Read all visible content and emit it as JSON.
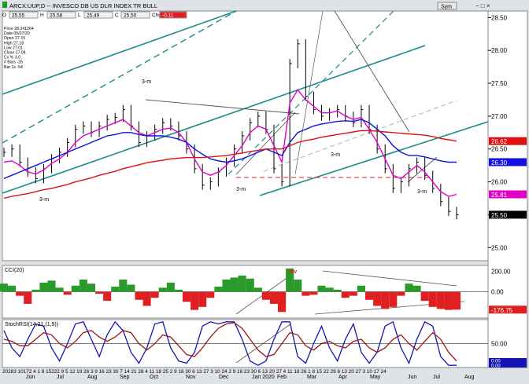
{
  "header": {
    "title": "ARCX:UUP,D -- INVESCO DB US DLR INDEX TR BULL",
    "open_label": "O",
    "open": "25.55",
    "high_label": "H",
    "high": "25.58",
    "low_label": "L",
    "low": "25.49",
    "close_label": "C",
    "close": "25.50",
    "change_label": "Chg",
    "change": "-0.11",
    "symbol_button": "Sym",
    "colors": {
      "up": "#1a9a1a",
      "down": "#e02020",
      "change_bg": "#e02020"
    }
  },
  "info_panel": {
    "lines": [
      "Price 28.241264",
      "Date 05/07/20",
      "Open 27.15",
      "High 27.18",
      "Low 27.01",
      "Close 27.04",
      "Cx % 3.0",
      "# Bars -26",
      "Bar 1s -54"
    ]
  },
  "chart_data": [
    {
      "panel": "price",
      "type": "line",
      "ylim": [
        24.8,
        28.6
      ],
      "y_ticks": [
        "28.50",
        "28.00",
        "27.50",
        "27.00",
        "26.50",
        "26.00",
        "25.50",
        "25.00"
      ],
      "x": [
        0,
        5,
        10,
        15,
        20,
        25,
        30,
        35,
        40,
        45,
        50,
        55,
        60,
        65,
        70,
        75,
        80,
        85,
        90,
        95,
        100,
        105,
        110,
        115,
        120,
        125,
        130,
        135,
        140,
        145,
        150,
        155,
        160,
        165,
        170,
        175,
        180,
        185,
        190,
        195,
        200,
        205,
        210,
        215,
        220,
        225,
        230,
        235,
        240,
        245,
        250,
        255,
        260,
        265,
        270,
        275,
        280,
        284
      ],
      "series": [
        {
          "values": [
            26.45,
            26.5,
            26.3,
            26.15,
            26.05,
            26.2,
            26.35,
            26.45,
            26.6,
            26.8,
            26.85,
            26.75,
            26.85,
            26.95,
            26.98,
            27.1,
            26.85,
            26.6,
            26.7,
            26.8,
            26.9,
            26.85,
            26.7,
            26.5,
            26.2,
            25.95,
            26.0,
            26.15,
            26.3,
            26.5,
            26.7,
            26.9,
            27.0,
            26.8,
            26.2,
            26.0,
            27.8,
            28.1,
            27.3,
            27.1,
            27.0,
            27.05,
            27.1,
            27.0,
            26.9,
            27.1,
            26.8,
            26.5,
            26.2,
            25.9,
            26.0,
            26.2,
            26.3,
            26.1,
            25.9,
            25.7,
            25.55,
            25.5
          ],
          "color": "#000000"
        },
        {
          "values": [
            26.3,
            26.32,
            26.25,
            26.15,
            26.12,
            26.18,
            26.28,
            26.35,
            26.45,
            26.6,
            26.7,
            26.75,
            26.8,
            26.85,
            26.9,
            26.95,
            26.85,
            26.75,
            26.7,
            26.75,
            26.8,
            26.82,
            26.75,
            26.6,
            26.35,
            26.15,
            26.1,
            26.15,
            26.25,
            26.4,
            26.55,
            26.75,
            26.85,
            26.8,
            26.55,
            26.3,
            27.2,
            27.4,
            27.25,
            27.15,
            27.05,
            27.05,
            27.08,
            27.0,
            26.95,
            26.98,
            26.8,
            26.6,
            26.35,
            26.1,
            26.05,
            26.15,
            26.25,
            26.15,
            26.0,
            25.85,
            25.78,
            25.81
          ],
          "color": "#e000c8"
        },
        {
          "values": [
            26.05,
            26.1,
            26.15,
            26.2,
            26.25,
            26.3,
            26.35,
            26.4,
            26.45,
            26.5,
            26.55,
            26.6,
            26.65,
            26.7,
            26.72,
            26.75,
            26.75,
            26.72,
            26.7,
            26.7,
            26.7,
            26.68,
            26.65,
            26.6,
            26.5,
            26.42,
            26.35,
            26.32,
            26.3,
            26.32,
            26.35,
            26.4,
            26.45,
            26.5,
            26.45,
            26.4,
            26.6,
            26.75,
            26.8,
            26.85,
            26.88,
            26.9,
            26.92,
            26.93,
            26.92,
            26.95,
            26.9,
            26.8,
            26.7,
            26.55,
            26.45,
            26.4,
            26.4,
            26.38,
            26.35,
            26.32,
            26.3,
            26.3
          ],
          "color": "#1010e0"
        },
        {
          "values": [
            25.75,
            25.78,
            25.8,
            25.82,
            25.85,
            25.88,
            25.9,
            25.93,
            25.96,
            26.0,
            26.03,
            26.06,
            26.1,
            26.13,
            26.16,
            26.2,
            26.23,
            26.26,
            26.29,
            26.31,
            26.33,
            26.35,
            26.36,
            26.37,
            26.37,
            26.37,
            26.38,
            26.39,
            26.4,
            26.42,
            26.44,
            26.46,
            26.48,
            26.5,
            26.5,
            26.5,
            26.55,
            26.6,
            26.63,
            26.65,
            26.68,
            26.7,
            26.72,
            26.74,
            26.76,
            26.78,
            26.78,
            26.77,
            26.76,
            26.75,
            26.74,
            26.73,
            26.72,
            26.71,
            26.69,
            26.66,
            26.64,
            26.62
          ],
          "color": "#e01010"
        }
      ],
      "value_tags": [
        {
          "value": "26.62",
          "y": 26.62,
          "color": "#e01010"
        },
        {
          "value": "26.30",
          "y": 26.3,
          "color": "#1010e0"
        },
        {
          "value": "25.81",
          "y": 25.81,
          "color": "#e000c8"
        },
        {
          "value": "25.50",
          "y": 25.5,
          "color": "#000000"
        }
      ],
      "annotations": [
        "3-m",
        "3-m",
        "3-m",
        "3-m",
        "3-m"
      ]
    },
    {
      "panel": "cci",
      "title": "CCI(20)",
      "type": "area",
      "ylim": [
        -260,
        260
      ],
      "y_ticks": [
        "200.00",
        "0.00"
      ],
      "value_tag": "-176.75",
      "annotation": "div",
      "values": [
        80,
        60,
        -40,
        -120,
        20,
        90,
        110,
        40,
        -30,
        60,
        120,
        80,
        -20,
        -90,
        50,
        120,
        70,
        -80,
        -140,
        -60,
        40,
        90,
        20,
        -100,
        -180,
        -150,
        -60,
        50,
        120,
        140,
        160,
        130,
        40,
        -80,
        -120,
        -200,
        230,
        120,
        -40,
        -30,
        60,
        40,
        20,
        -60,
        -40,
        60,
        -80,
        -140,
        -170,
        -150,
        -40,
        80,
        60,
        -90,
        -150,
        -170,
        -180,
        -176.75
      ]
    },
    {
      "panel": "stochrsi",
      "title": "StochRSI(14,21,(1,9))",
      "type": "line",
      "ylim": [
        -5,
        105
      ],
      "y_ticks": [
        "50.00",
        "0.00"
      ],
      "value_tags": [
        "0.00",
        "0.00"
      ],
      "series": [
        {
          "values": [
            80,
            40,
            20,
            60,
            95,
            90,
            40,
            10,
            50,
            95,
            100,
            60,
            20,
            70,
            100,
            80,
            30,
            5,
            40,
            95,
            100,
            40,
            10,
            5,
            30,
            90,
            100,
            95,
            100,
            100,
            60,
            10,
            0,
            10,
            60,
            100,
            100,
            20,
            5,
            50,
            90,
            40,
            10,
            60,
            95,
            30,
            5,
            30,
            90,
            100,
            40,
            5,
            60,
            100,
            90,
            20,
            0,
            0
          ],
          "color": "#1414b4"
        },
        {
          "values": [
            60,
            55,
            45,
            45,
            60,
            75,
            70,
            50,
            40,
            55,
            75,
            80,
            65,
            55,
            65,
            80,
            75,
            50,
            35,
            50,
            70,
            65,
            45,
            25,
            20,
            40,
            65,
            85,
            95,
            98,
            85,
            60,
            35,
            20,
            25,
            50,
            75,
            70,
            45,
            35,
            50,
            55,
            45,
            40,
            55,
            60,
            40,
            30,
            40,
            60,
            70,
            50,
            35,
            55,
            75,
            60,
            30,
            10
          ],
          "color": "#a01414"
        }
      ]
    }
  ],
  "x_axis": {
    "day_labels": "20283 10172 4 1 8  15222 9 5 12 19 26 3 9 16 23 30 7 14 21 28 4 11 18 25 2 9 16  30 6 13  27 3 10  24 2 9 16 23 30 6 13 20 27 4 11 18 26 1 8 15 22 29 6 13 20 27 3 10 17 24",
    "month_labels": [
      "Jun",
      "Jul",
      "Aug",
      "Sep",
      "Oct",
      "Nov",
      "Dec",
      "Jan 2020",
      "Feb",
      "Mar",
      "Apr",
      "May",
      "Jun",
      "Jul",
      "Aug"
    ]
  },
  "toolbar": {
    "sym_button": "Sym",
    "win_buttons": [
      "−",
      "□",
      "×"
    ]
  }
}
